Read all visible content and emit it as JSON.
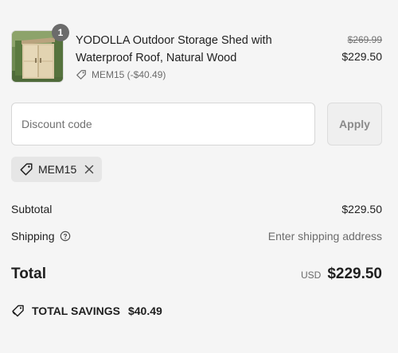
{
  "product": {
    "quantity": "1",
    "name": "YODOLLA Outdoor Storage Shed with Waterproof Roof, Natural Wood",
    "discount_label": "MEM15 (-$40.49)",
    "original_price": "$269.99",
    "price": "$229.50",
    "image_icon": "wooden-shed-thumbnail"
  },
  "discount": {
    "placeholder": "Discount code",
    "value": "",
    "apply_label": "Apply",
    "applied_code": "MEM15"
  },
  "summary": {
    "subtotal_label": "Subtotal",
    "subtotal_value": "$229.50",
    "shipping_label": "Shipping",
    "shipping_value": "Enter shipping address",
    "total_label": "Total",
    "currency": "USD",
    "total_value": "$229.50",
    "savings_label": "TOTAL SAVINGS",
    "savings_value": "$40.49"
  },
  "colors": {
    "background": "#f5f5f5",
    "text": "#1f1f1f",
    "muted": "#6b6b6b",
    "badge": "#6b6b6b",
    "chip": "#e6e6e6"
  }
}
